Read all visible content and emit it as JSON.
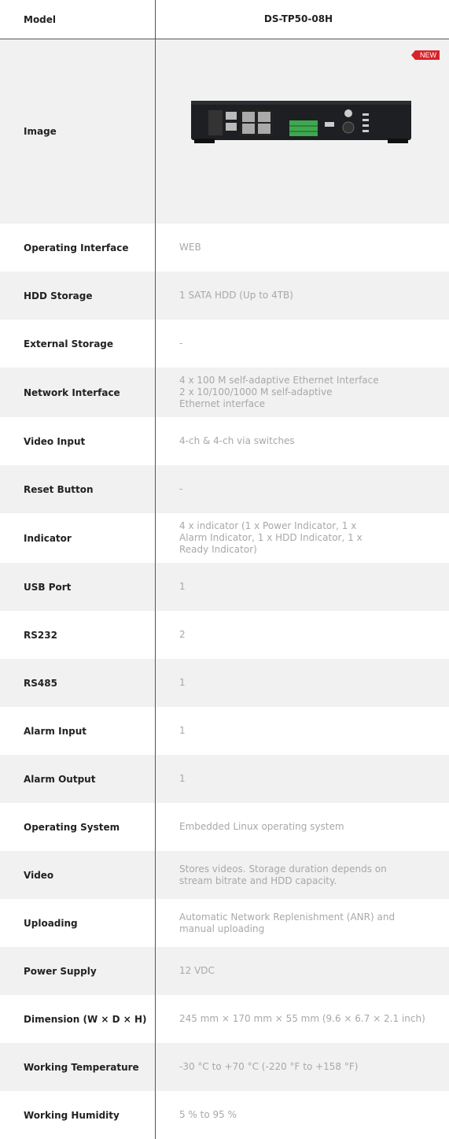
{
  "header": {
    "model_label": "Model",
    "model_value": "DS-TP50-08H"
  },
  "image_row": {
    "label": "Image",
    "badge": "NEW"
  },
  "specs": [
    {
      "label": "Operating Interface",
      "value": "WEB"
    },
    {
      "label": "HDD Storage",
      "value": "1 SATA HDD (Up to 4TB)"
    },
    {
      "label": "External Storage",
      "value": "-"
    },
    {
      "label": "Network Interface",
      "value": "4 x 100 M self-adaptive Ethernet  Interface\n2 x 10/100/1000 M self-adaptive\nEthernet interface"
    },
    {
      "label": "Video Input",
      "value": "4-ch & 4-ch via switches"
    },
    {
      "label": "Reset Button",
      "value": "-"
    },
    {
      "label": "Indicator",
      "value": "4 x indicator (1 x Power Indicator, 1 x\nAlarm Indicator, 1 x HDD Indicator, 1 x\nReady Indicator)"
    },
    {
      "label": "USB Port",
      "value": "1"
    },
    {
      "label": "RS232",
      "value": "2"
    },
    {
      "label": "RS485",
      "value": "1"
    },
    {
      "label": "Alarm Input",
      "value": "1"
    },
    {
      "label": "Alarm Output",
      "value": "1"
    },
    {
      "label": "Operating System",
      "value": "Embedded Linux operating system"
    },
    {
      "label": "Video",
      "value": "Stores videos. Storage duration depends on\nstream bitrate and HDD capacity."
    },
    {
      "label": "Uploading",
      "value": "Automatic Network Replenishment (ANR) and\nmanual uploading"
    },
    {
      "label": "Power Supply",
      "value": "12 VDC"
    },
    {
      "label": "Dimension (W × D × H)",
      "value": "245 mm × 170 mm × 55 mm (9.6 × 6.7 × 2.1 inch)"
    },
    {
      "label": "Working Temperature",
      "value": "-30 °C to +70 °C (-220 °F to +158 °F)"
    },
    {
      "label": "Working Humidity",
      "value": "5 % to 95 %"
    }
  ]
}
